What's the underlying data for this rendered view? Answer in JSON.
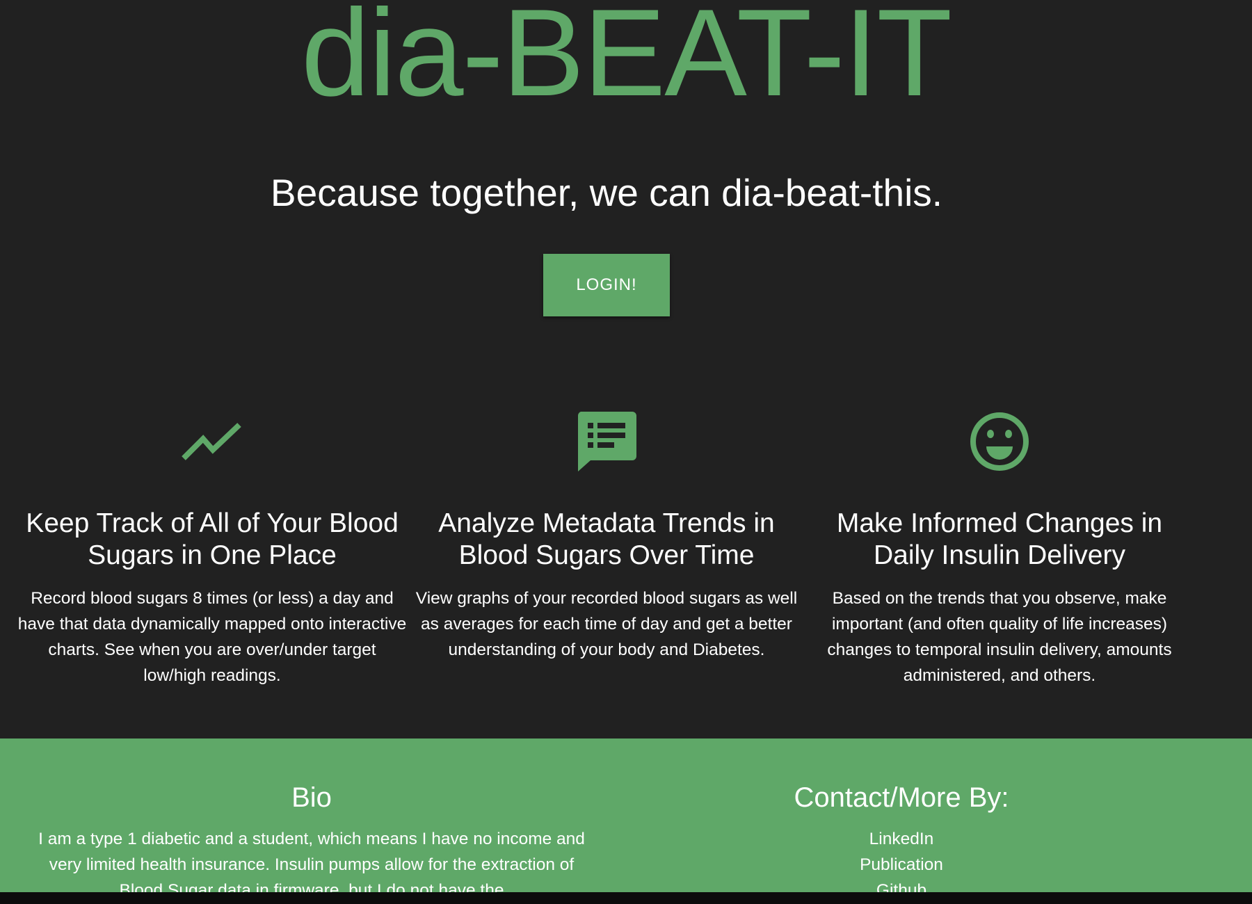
{
  "header": {
    "title": "dia-BEAT-IT",
    "tagline": "Because together, we can dia-beat-this.",
    "login_label": "LOGIN!"
  },
  "colors": {
    "accent": "#5fa868",
    "background": "#212121"
  },
  "features": [
    {
      "icon": "trending-up-icon",
      "heading": "Keep Track of All of Your Blood Sugars in One Place",
      "text": "Record blood sugars 8 times (or less) a day and have that data dynamically mapped onto interactive charts. See when you are over/under target low/high readings."
    },
    {
      "icon": "list-chat-icon",
      "heading": "Analyze Metadata Trends in Blood Sugars Over Time",
      "text": "View graphs of your recorded blood sugars as well as averages for each time of day and get a better understanding of your body and Diabetes."
    },
    {
      "icon": "smiley-icon",
      "heading": "Make Informed Changes in Daily Insulin Delivery",
      "text": "Based on the trends that you observe, make important (and often quality of life increases) changes to temporal insulin delivery, amounts administered, and others."
    }
  ],
  "footer": {
    "bio_heading": "Bio",
    "bio_text": "I am a type 1 diabetic and a student, which means I have no income and very limited health insurance. Insulin pumps allow for the extraction of Blood Sugar data in firmware, but I do not have the",
    "contact_heading": "Contact/More By:",
    "links": [
      "LinkedIn",
      "Publication",
      "Github"
    ]
  }
}
